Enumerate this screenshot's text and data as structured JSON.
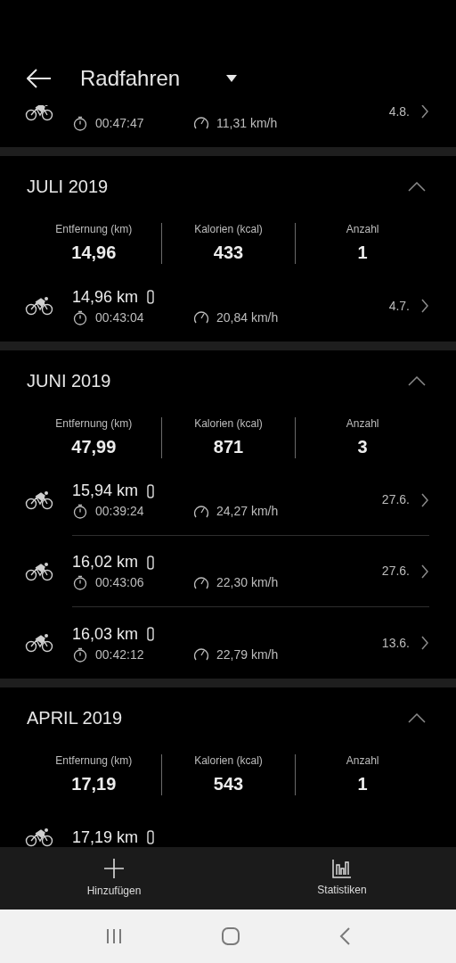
{
  "header": {
    "title": "Radfahren"
  },
  "partial_entry": {
    "duration": "00:47:47",
    "speed": "11,31 km/h",
    "date": "4.8."
  },
  "sections": [
    {
      "title": "JULI 2019",
      "expanded": true,
      "stats": [
        {
          "label": "Entfernung (km)",
          "value": "14,96"
        },
        {
          "label": "Kalorien (kcal)",
          "value": "433"
        },
        {
          "label": "Anzahl",
          "value": "1"
        }
      ],
      "entries": [
        {
          "distance": "14,96 km",
          "duration": "00:43:04",
          "speed": "20,84 km/h",
          "date": "4.7."
        }
      ]
    },
    {
      "title": "JUNI 2019",
      "expanded": true,
      "stats": [
        {
          "label": "Entfernung (km)",
          "value": "47,99"
        },
        {
          "label": "Kalorien (kcal)",
          "value": "871"
        },
        {
          "label": "Anzahl",
          "value": "3"
        }
      ],
      "entries": [
        {
          "distance": "15,94 km",
          "duration": "00:39:24",
          "speed": "24,27 km/h",
          "date": "27.6."
        },
        {
          "distance": "16,02 km",
          "duration": "00:43:06",
          "speed": "22,30 km/h",
          "date": "27.6."
        },
        {
          "distance": "16,03 km",
          "duration": "00:42:12",
          "speed": "22,79 km/h",
          "date": "13.6."
        }
      ]
    },
    {
      "title": "APRIL 2019",
      "expanded": true,
      "stats": [
        {
          "label": "Entfernung (km)",
          "value": "17,19"
        },
        {
          "label": "Kalorien (kcal)",
          "value": "543"
        },
        {
          "label": "Anzahl",
          "value": "1"
        }
      ],
      "entries": [
        {
          "distance": "17,19 km"
        }
      ]
    }
  ],
  "bottom_bar": [
    {
      "label": "Hinzufügen",
      "kind": "add"
    },
    {
      "label": "Statistiken",
      "kind": "stats"
    }
  ]
}
